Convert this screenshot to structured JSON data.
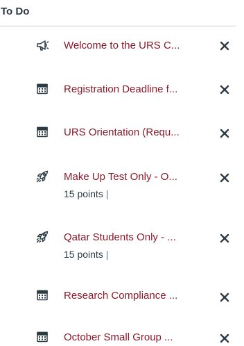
{
  "todo": {
    "title": "To Do",
    "items": [
      {
        "icon": "announcement-icon",
        "label": "Welcome to the URS C...",
        "points": null
      },
      {
        "icon": "calendar-icon",
        "label": "Registration Deadline f...",
        "points": null
      },
      {
        "icon": "calendar-icon",
        "label": "URS Orientation (Requ...",
        "points": null
      },
      {
        "icon": "rocket-icon",
        "label": "Make Up Test Only - O...",
        "points": "15 points",
        "separator": "|"
      },
      {
        "icon": "rocket-icon",
        "label": "Qatar Students Only - ...",
        "points": "15 points",
        "separator": "|"
      },
      {
        "icon": "calendar-icon",
        "label": "Research Compliance ...",
        "points": null
      },
      {
        "icon": "calendar-icon",
        "label": "October Small Group ...",
        "points": null
      }
    ]
  },
  "colors": {
    "link": "#8b1a2b",
    "text": "#2d3b45",
    "divider": "#c7cdd1"
  }
}
